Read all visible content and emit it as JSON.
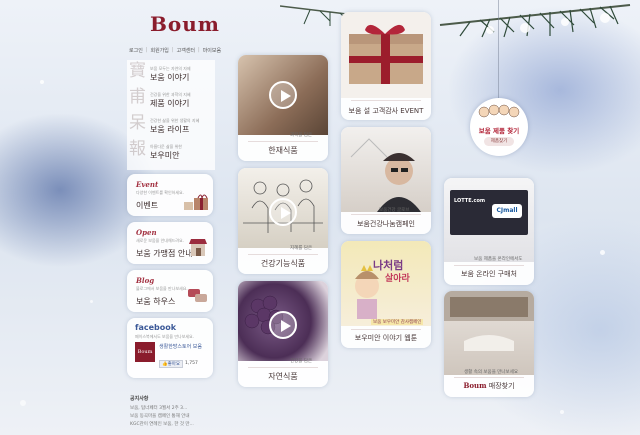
{
  "brand": {
    "logo": "Boum"
  },
  "top_menu": [
    "로그인",
    "회원가입",
    "고객센터",
    "마이보움"
  ],
  "left_nav": {
    "hanja": "寶甫呆報",
    "items": [
      {
        "sub": "보움 모두는 자연의 자제",
        "label": "보움 이야기"
      },
      {
        "sub": "건강을 위한 과학의 지혜",
        "label": "제품 이야기"
      },
      {
        "sub": "건강한 삶을 위한 생활의 지혜",
        "label": "보움 라이프"
      },
      {
        "sub": "아름다운 삶을 위한",
        "label": "보우미안"
      }
    ]
  },
  "side_cards": {
    "event": {
      "title": "Event",
      "desc": "다양한 이벤트를 확인하세요.",
      "label": "이벤트"
    },
    "open": {
      "title": "Open",
      "desc": "새로운 보움을 안내해드려요.",
      "label": "보움 가맹점 안내"
    },
    "blog": {
      "title": "Blog",
      "desc": "블로그에서 보움을 만나보세요.",
      "label": "보움 하우스"
    },
    "facebook": {
      "title": "facebook",
      "desc": "페이스북에서도 보움을 만나보세요.",
      "page_name": "생활한방스토어 보움",
      "like": "좋아요",
      "count": "1,757"
    }
  },
  "tiles": {
    "korean": {
      "tag": "과학을 담은",
      "caption": "한재식품"
    },
    "functional": {
      "tag": "지혜를 담은",
      "caption": "건강기능식품"
    },
    "natural": {
      "tag": "건강을 담은",
      "caption": "자연식품"
    },
    "gift": {
      "caption": "보움 설 고객감사 EVENT"
    },
    "campaign": {
      "tag": "보움건강 글로브",
      "caption": "보움건강나눔캠페인"
    },
    "webtoon": {
      "banner_line1": "나처럼",
      "banner_line2": "살아라",
      "tag": "보움 보우미안 감사캠페인",
      "caption": "보우미안 이야기 웹툰"
    },
    "online": {
      "tag": "보움 제품을 온라인에서도",
      "brand1": "LOTTE.com",
      "brand2": "CJmall",
      "caption": "보움 온라인 구매처"
    },
    "store": {
      "tag": "생활 속의 보움을 만나보세요",
      "logo": "Boum",
      "caption": "매장찾기"
    }
  },
  "ornament": {
    "title": "보움 제품 찾기",
    "button": "제품찾기"
  },
  "notice": {
    "title": "공지사항",
    "lines": [
      "보움, 탑너페터 3월서 2주 3...",
      "보움 동곡마을 캠페인 통해 안내",
      "KGC관이 연례인 보움, 한 것 만..."
    ]
  }
}
